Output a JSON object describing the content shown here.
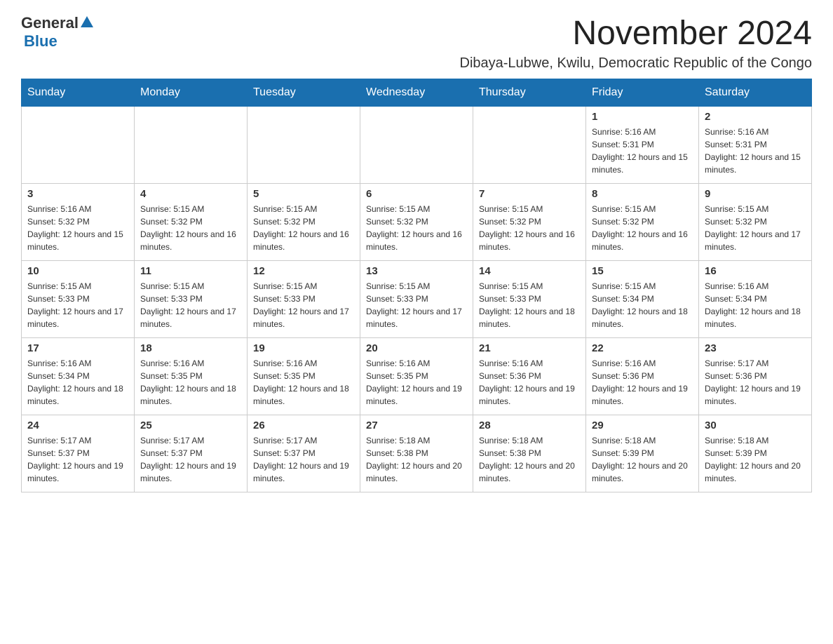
{
  "logo": {
    "text_general": "General",
    "text_blue": "Blue"
  },
  "title": {
    "month_year": "November 2024",
    "location": "Dibaya-Lubwe, Kwilu, Democratic Republic of the Congo"
  },
  "days_of_week": [
    "Sunday",
    "Monday",
    "Tuesday",
    "Wednesday",
    "Thursday",
    "Friday",
    "Saturday"
  ],
  "weeks": [
    [
      {
        "day": "",
        "sunrise": "",
        "sunset": "",
        "daylight": ""
      },
      {
        "day": "",
        "sunrise": "",
        "sunset": "",
        "daylight": ""
      },
      {
        "day": "",
        "sunrise": "",
        "sunset": "",
        "daylight": ""
      },
      {
        "day": "",
        "sunrise": "",
        "sunset": "",
        "daylight": ""
      },
      {
        "day": "",
        "sunrise": "",
        "sunset": "",
        "daylight": ""
      },
      {
        "day": "1",
        "sunrise": "Sunrise: 5:16 AM",
        "sunset": "Sunset: 5:31 PM",
        "daylight": "Daylight: 12 hours and 15 minutes."
      },
      {
        "day": "2",
        "sunrise": "Sunrise: 5:16 AM",
        "sunset": "Sunset: 5:31 PM",
        "daylight": "Daylight: 12 hours and 15 minutes."
      }
    ],
    [
      {
        "day": "3",
        "sunrise": "Sunrise: 5:16 AM",
        "sunset": "Sunset: 5:32 PM",
        "daylight": "Daylight: 12 hours and 15 minutes."
      },
      {
        "day": "4",
        "sunrise": "Sunrise: 5:15 AM",
        "sunset": "Sunset: 5:32 PM",
        "daylight": "Daylight: 12 hours and 16 minutes."
      },
      {
        "day": "5",
        "sunrise": "Sunrise: 5:15 AM",
        "sunset": "Sunset: 5:32 PM",
        "daylight": "Daylight: 12 hours and 16 minutes."
      },
      {
        "day": "6",
        "sunrise": "Sunrise: 5:15 AM",
        "sunset": "Sunset: 5:32 PM",
        "daylight": "Daylight: 12 hours and 16 minutes."
      },
      {
        "day": "7",
        "sunrise": "Sunrise: 5:15 AM",
        "sunset": "Sunset: 5:32 PM",
        "daylight": "Daylight: 12 hours and 16 minutes."
      },
      {
        "day": "8",
        "sunrise": "Sunrise: 5:15 AM",
        "sunset": "Sunset: 5:32 PM",
        "daylight": "Daylight: 12 hours and 16 minutes."
      },
      {
        "day": "9",
        "sunrise": "Sunrise: 5:15 AM",
        "sunset": "Sunset: 5:32 PM",
        "daylight": "Daylight: 12 hours and 17 minutes."
      }
    ],
    [
      {
        "day": "10",
        "sunrise": "Sunrise: 5:15 AM",
        "sunset": "Sunset: 5:33 PM",
        "daylight": "Daylight: 12 hours and 17 minutes."
      },
      {
        "day": "11",
        "sunrise": "Sunrise: 5:15 AM",
        "sunset": "Sunset: 5:33 PM",
        "daylight": "Daylight: 12 hours and 17 minutes."
      },
      {
        "day": "12",
        "sunrise": "Sunrise: 5:15 AM",
        "sunset": "Sunset: 5:33 PM",
        "daylight": "Daylight: 12 hours and 17 minutes."
      },
      {
        "day": "13",
        "sunrise": "Sunrise: 5:15 AM",
        "sunset": "Sunset: 5:33 PM",
        "daylight": "Daylight: 12 hours and 17 minutes."
      },
      {
        "day": "14",
        "sunrise": "Sunrise: 5:15 AM",
        "sunset": "Sunset: 5:33 PM",
        "daylight": "Daylight: 12 hours and 18 minutes."
      },
      {
        "day": "15",
        "sunrise": "Sunrise: 5:15 AM",
        "sunset": "Sunset: 5:34 PM",
        "daylight": "Daylight: 12 hours and 18 minutes."
      },
      {
        "day": "16",
        "sunrise": "Sunrise: 5:16 AM",
        "sunset": "Sunset: 5:34 PM",
        "daylight": "Daylight: 12 hours and 18 minutes."
      }
    ],
    [
      {
        "day": "17",
        "sunrise": "Sunrise: 5:16 AM",
        "sunset": "Sunset: 5:34 PM",
        "daylight": "Daylight: 12 hours and 18 minutes."
      },
      {
        "day": "18",
        "sunrise": "Sunrise: 5:16 AM",
        "sunset": "Sunset: 5:35 PM",
        "daylight": "Daylight: 12 hours and 18 minutes."
      },
      {
        "day": "19",
        "sunrise": "Sunrise: 5:16 AM",
        "sunset": "Sunset: 5:35 PM",
        "daylight": "Daylight: 12 hours and 18 minutes."
      },
      {
        "day": "20",
        "sunrise": "Sunrise: 5:16 AM",
        "sunset": "Sunset: 5:35 PM",
        "daylight": "Daylight: 12 hours and 19 minutes."
      },
      {
        "day": "21",
        "sunrise": "Sunrise: 5:16 AM",
        "sunset": "Sunset: 5:36 PM",
        "daylight": "Daylight: 12 hours and 19 minutes."
      },
      {
        "day": "22",
        "sunrise": "Sunrise: 5:16 AM",
        "sunset": "Sunset: 5:36 PM",
        "daylight": "Daylight: 12 hours and 19 minutes."
      },
      {
        "day": "23",
        "sunrise": "Sunrise: 5:17 AM",
        "sunset": "Sunset: 5:36 PM",
        "daylight": "Daylight: 12 hours and 19 minutes."
      }
    ],
    [
      {
        "day": "24",
        "sunrise": "Sunrise: 5:17 AM",
        "sunset": "Sunset: 5:37 PM",
        "daylight": "Daylight: 12 hours and 19 minutes."
      },
      {
        "day": "25",
        "sunrise": "Sunrise: 5:17 AM",
        "sunset": "Sunset: 5:37 PM",
        "daylight": "Daylight: 12 hours and 19 minutes."
      },
      {
        "day": "26",
        "sunrise": "Sunrise: 5:17 AM",
        "sunset": "Sunset: 5:37 PM",
        "daylight": "Daylight: 12 hours and 19 minutes."
      },
      {
        "day": "27",
        "sunrise": "Sunrise: 5:18 AM",
        "sunset": "Sunset: 5:38 PM",
        "daylight": "Daylight: 12 hours and 20 minutes."
      },
      {
        "day": "28",
        "sunrise": "Sunrise: 5:18 AM",
        "sunset": "Sunset: 5:38 PM",
        "daylight": "Daylight: 12 hours and 20 minutes."
      },
      {
        "day": "29",
        "sunrise": "Sunrise: 5:18 AM",
        "sunset": "Sunset: 5:39 PM",
        "daylight": "Daylight: 12 hours and 20 minutes."
      },
      {
        "day": "30",
        "sunrise": "Sunrise: 5:18 AM",
        "sunset": "Sunset: 5:39 PM",
        "daylight": "Daylight: 12 hours and 20 minutes."
      }
    ]
  ]
}
